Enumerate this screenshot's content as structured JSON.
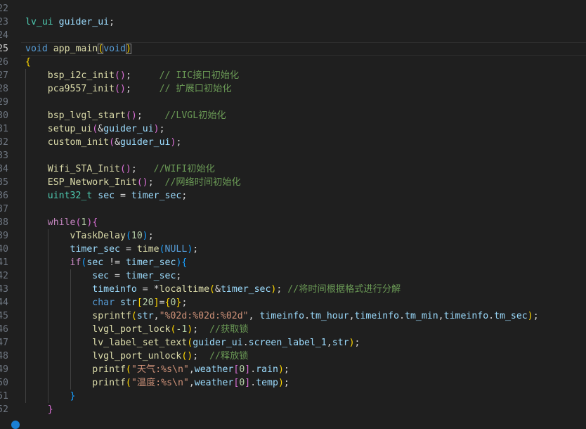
{
  "editor": {
    "active_line": "25",
    "lines": [
      {
        "num": "22",
        "tokens": []
      },
      {
        "num": "23",
        "tokens": [
          {
            "t": "lv_ui",
            "c": "ty"
          },
          {
            "t": " ",
            "c": "pun"
          },
          {
            "t": "guider_ui",
            "c": "var"
          },
          {
            "t": ";",
            "c": "pun"
          }
        ]
      },
      {
        "num": "24",
        "tokens": []
      },
      {
        "num": "25",
        "tokens": [
          {
            "t": "void",
            "c": "kw"
          },
          {
            "t": " ",
            "c": "pun"
          },
          {
            "t": "app_main",
            "c": "fn"
          },
          {
            "t": "(",
            "c": "br1",
            "m": 1
          },
          {
            "t": "void",
            "c": "kw"
          },
          {
            "t": ")",
            "c": "br1",
            "m": 1
          }
        ]
      },
      {
        "num": "26",
        "tokens": [
          {
            "t": "{",
            "c": "br1"
          }
        ]
      },
      {
        "num": "27",
        "tokens": [
          {
            "t": "    ",
            "c": "pun"
          },
          {
            "t": "bsp_i2c_init",
            "c": "fn"
          },
          {
            "t": "()",
            "c": "br2"
          },
          {
            "t": ";     ",
            "c": "pun"
          },
          {
            "t": "// IIC接口初始化",
            "c": "cmt"
          }
        ]
      },
      {
        "num": "28",
        "tokens": [
          {
            "t": "    ",
            "c": "pun"
          },
          {
            "t": "pca9557_init",
            "c": "fn"
          },
          {
            "t": "()",
            "c": "br2"
          },
          {
            "t": ";     ",
            "c": "pun"
          },
          {
            "t": "// 扩展口初始化",
            "c": "cmt"
          }
        ]
      },
      {
        "num": "29",
        "tokens": []
      },
      {
        "num": "30",
        "tokens": [
          {
            "t": "    ",
            "c": "pun"
          },
          {
            "t": "bsp_lvgl_start",
            "c": "fn"
          },
          {
            "t": "()",
            "c": "br2"
          },
          {
            "t": ";    ",
            "c": "pun"
          },
          {
            "t": "//LVGL初始化",
            "c": "cmt"
          }
        ]
      },
      {
        "num": "31",
        "tokens": [
          {
            "t": "    ",
            "c": "pun"
          },
          {
            "t": "setup_ui",
            "c": "fn"
          },
          {
            "t": "(",
            "c": "br2"
          },
          {
            "t": "&",
            "c": "pun"
          },
          {
            "t": "guider_ui",
            "c": "var"
          },
          {
            "t": ")",
            "c": "br2"
          },
          {
            "t": ";",
            "c": "pun"
          }
        ]
      },
      {
        "num": "32",
        "tokens": [
          {
            "t": "    ",
            "c": "pun"
          },
          {
            "t": "custom_init",
            "c": "fn"
          },
          {
            "t": "(",
            "c": "br2"
          },
          {
            "t": "&",
            "c": "pun"
          },
          {
            "t": "guider_ui",
            "c": "var"
          },
          {
            "t": ")",
            "c": "br2"
          },
          {
            "t": ";",
            "c": "pun"
          }
        ]
      },
      {
        "num": "33",
        "tokens": []
      },
      {
        "num": "34",
        "tokens": [
          {
            "t": "    ",
            "c": "pun"
          },
          {
            "t": "Wifi_STA_Init",
            "c": "fn"
          },
          {
            "t": "()",
            "c": "br2"
          },
          {
            "t": ";   ",
            "c": "pun"
          },
          {
            "t": "//WIFI初始化",
            "c": "cmt"
          }
        ]
      },
      {
        "num": "35",
        "tokens": [
          {
            "t": "    ",
            "c": "pun"
          },
          {
            "t": "ESP_Network_Init",
            "c": "fn"
          },
          {
            "t": "()",
            "c": "br2"
          },
          {
            "t": ";  ",
            "c": "pun"
          },
          {
            "t": "//网络时间初始化",
            "c": "cmt"
          }
        ]
      },
      {
        "num": "36",
        "tokens": [
          {
            "t": "    ",
            "c": "pun"
          },
          {
            "t": "uint32_t",
            "c": "ty"
          },
          {
            "t": " ",
            "c": "pun"
          },
          {
            "t": "sec",
            "c": "var"
          },
          {
            "t": " = ",
            "c": "pun"
          },
          {
            "t": "timer_sec",
            "c": "var"
          },
          {
            "t": ";",
            "c": "pun"
          }
        ]
      },
      {
        "num": "37",
        "tokens": []
      },
      {
        "num": "38",
        "tokens": [
          {
            "t": "    ",
            "c": "pun"
          },
          {
            "t": "while",
            "c": "ctl"
          },
          {
            "t": "(",
            "c": "br2"
          },
          {
            "t": "1",
            "c": "num"
          },
          {
            "t": ")",
            "c": "br2"
          },
          {
            "t": "{",
            "c": "br2"
          }
        ]
      },
      {
        "num": "39",
        "tokens": [
          {
            "t": "        ",
            "c": "pun"
          },
          {
            "t": "vTaskDelay",
            "c": "fn"
          },
          {
            "t": "(",
            "c": "br3"
          },
          {
            "t": "10",
            "c": "num"
          },
          {
            "t": ")",
            "c": "br3"
          },
          {
            "t": ";",
            "c": "pun"
          }
        ]
      },
      {
        "num": "40",
        "tokens": [
          {
            "t": "        ",
            "c": "pun"
          },
          {
            "t": "timer_sec",
            "c": "var"
          },
          {
            "t": " = ",
            "c": "pun"
          },
          {
            "t": "time",
            "c": "fn"
          },
          {
            "t": "(",
            "c": "br3"
          },
          {
            "t": "NULL",
            "c": "kw"
          },
          {
            "t": ")",
            "c": "br3"
          },
          {
            "t": ";",
            "c": "pun"
          }
        ]
      },
      {
        "num": "41",
        "tokens": [
          {
            "t": "        ",
            "c": "pun"
          },
          {
            "t": "if",
            "c": "ctl"
          },
          {
            "t": "(",
            "c": "br3"
          },
          {
            "t": "sec",
            "c": "var"
          },
          {
            "t": " != ",
            "c": "pun"
          },
          {
            "t": "timer_sec",
            "c": "var"
          },
          {
            "t": ")",
            "c": "br3"
          },
          {
            "t": "{",
            "c": "br3"
          }
        ]
      },
      {
        "num": "42",
        "tokens": [
          {
            "t": "            ",
            "c": "pun"
          },
          {
            "t": "sec",
            "c": "var"
          },
          {
            "t": " = ",
            "c": "pun"
          },
          {
            "t": "timer_sec",
            "c": "var"
          },
          {
            "t": ";",
            "c": "pun"
          }
        ]
      },
      {
        "num": "43",
        "tokens": [
          {
            "t": "            ",
            "c": "pun"
          },
          {
            "t": "timeinfo",
            "c": "var"
          },
          {
            "t": " = *",
            "c": "pun"
          },
          {
            "t": "localtime",
            "c": "fn"
          },
          {
            "t": "(",
            "c": "br1"
          },
          {
            "t": "&",
            "c": "pun"
          },
          {
            "t": "timer_sec",
            "c": "var"
          },
          {
            "t": ")",
            "c": "br1"
          },
          {
            "t": "; ",
            "c": "pun"
          },
          {
            "t": "//将时间根据格式进行分解",
            "c": "cmt"
          }
        ]
      },
      {
        "num": "44",
        "tokens": [
          {
            "t": "            ",
            "c": "pun"
          },
          {
            "t": "char",
            "c": "kw"
          },
          {
            "t": " ",
            "c": "pun"
          },
          {
            "t": "str",
            "c": "var"
          },
          {
            "t": "[",
            "c": "br1"
          },
          {
            "t": "20",
            "c": "num"
          },
          {
            "t": "]",
            "c": "br1"
          },
          {
            "t": "=",
            "c": "pun"
          },
          {
            "t": "{",
            "c": "br1"
          },
          {
            "t": "0",
            "c": "num"
          },
          {
            "t": "}",
            "c": "br1"
          },
          {
            "t": ";",
            "c": "pun"
          }
        ]
      },
      {
        "num": "45",
        "tokens": [
          {
            "t": "            ",
            "c": "pun"
          },
          {
            "t": "sprintf",
            "c": "fn"
          },
          {
            "t": "(",
            "c": "br1"
          },
          {
            "t": "str",
            "c": "var"
          },
          {
            "t": ",",
            "c": "pun"
          },
          {
            "t": "\"%02d:%02d:%02d\"",
            "c": "str"
          },
          {
            "t": ", ",
            "c": "pun"
          },
          {
            "t": "timeinfo",
            "c": "var"
          },
          {
            "t": ".",
            "c": "pun"
          },
          {
            "t": "tm_hour",
            "c": "var"
          },
          {
            "t": ",",
            "c": "pun"
          },
          {
            "t": "timeinfo",
            "c": "var"
          },
          {
            "t": ".",
            "c": "pun"
          },
          {
            "t": "tm_min",
            "c": "var"
          },
          {
            "t": ",",
            "c": "pun"
          },
          {
            "t": "timeinfo",
            "c": "var"
          },
          {
            "t": ".",
            "c": "pun"
          },
          {
            "t": "tm_sec",
            "c": "var"
          },
          {
            "t": ")",
            "c": "br1"
          },
          {
            "t": ";",
            "c": "pun"
          }
        ]
      },
      {
        "num": "46",
        "tokens": [
          {
            "t": "            ",
            "c": "pun"
          },
          {
            "t": "lvgl_port_lock",
            "c": "fn"
          },
          {
            "t": "(",
            "c": "br1"
          },
          {
            "t": "-1",
            "c": "num"
          },
          {
            "t": ")",
            "c": "br1"
          },
          {
            "t": ";  ",
            "c": "pun"
          },
          {
            "t": "//获取锁",
            "c": "cmt"
          }
        ]
      },
      {
        "num": "47",
        "tokens": [
          {
            "t": "            ",
            "c": "pun"
          },
          {
            "t": "lv_label_set_text",
            "c": "fn"
          },
          {
            "t": "(",
            "c": "br1"
          },
          {
            "t": "guider_ui",
            "c": "var"
          },
          {
            "t": ".",
            "c": "pun"
          },
          {
            "t": "screen_label_1",
            "c": "var"
          },
          {
            "t": ",",
            "c": "pun"
          },
          {
            "t": "str",
            "c": "var"
          },
          {
            "t": ")",
            "c": "br1"
          },
          {
            "t": ";",
            "c": "pun"
          }
        ]
      },
      {
        "num": "48",
        "tokens": [
          {
            "t": "            ",
            "c": "pun"
          },
          {
            "t": "lvgl_port_unlock",
            "c": "fn"
          },
          {
            "t": "()",
            "c": "br1"
          },
          {
            "t": ";  ",
            "c": "pun"
          },
          {
            "t": "//释放锁",
            "c": "cmt"
          }
        ]
      },
      {
        "num": "49",
        "tokens": [
          {
            "t": "            ",
            "c": "pun"
          },
          {
            "t": "printf",
            "c": "fn"
          },
          {
            "t": "(",
            "c": "br1"
          },
          {
            "t": "\"天气:%s\\n\"",
            "c": "str"
          },
          {
            "t": ",",
            "c": "pun"
          },
          {
            "t": "weather",
            "c": "var"
          },
          {
            "t": "[",
            "c": "br2"
          },
          {
            "t": "0",
            "c": "num"
          },
          {
            "t": "]",
            "c": "br2"
          },
          {
            "t": ".",
            "c": "pun"
          },
          {
            "t": "rain",
            "c": "var"
          },
          {
            "t": ")",
            "c": "br1"
          },
          {
            "t": ";",
            "c": "pun"
          }
        ]
      },
      {
        "num": "50",
        "tokens": [
          {
            "t": "            ",
            "c": "pun"
          },
          {
            "t": "printf",
            "c": "fn"
          },
          {
            "t": "(",
            "c": "br1"
          },
          {
            "t": "\"温度:%s\\n\"",
            "c": "str"
          },
          {
            "t": ",",
            "c": "pun"
          },
          {
            "t": "weather",
            "c": "var"
          },
          {
            "t": "[",
            "c": "br2"
          },
          {
            "t": "0",
            "c": "num"
          },
          {
            "t": "]",
            "c": "br2"
          },
          {
            "t": ".",
            "c": "pun"
          },
          {
            "t": "temp",
            "c": "var"
          },
          {
            "t": ")",
            "c": "br1"
          },
          {
            "t": ";",
            "c": "pun"
          }
        ]
      },
      {
        "num": "51",
        "tokens": [
          {
            "t": "        ",
            "c": "pun"
          },
          {
            "t": "}",
            "c": "br3"
          }
        ]
      },
      {
        "num": "52",
        "tokens": [
          {
            "t": "    ",
            "c": "pun"
          },
          {
            "t": "}",
            "c": "br2"
          }
        ]
      }
    ]
  }
}
